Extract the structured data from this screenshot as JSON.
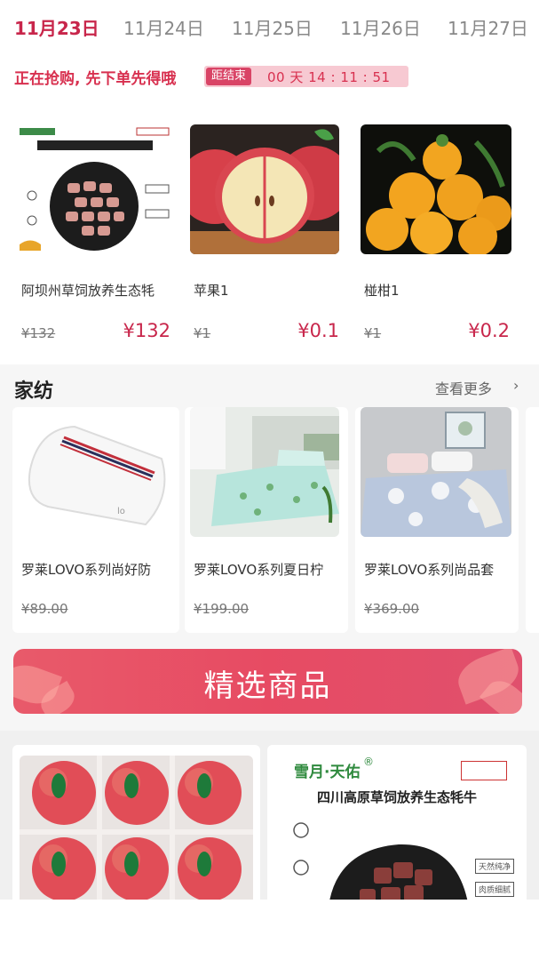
{
  "date_tabs": [
    "11月23日",
    "11月24日",
    "11月25日",
    "11月26日",
    "11月27日"
  ],
  "flash": {
    "title": "正在抢购, 先下单先得哦",
    "countdown_label": "距结束",
    "countdown_time": "00 天 14 : 11 : 51",
    "items": [
      {
        "name": "阿坝州草饲放养生态牦",
        "orig": "¥132",
        "price": "¥132",
        "image": "beef-package-image"
      },
      {
        "name": "苹果1",
        "orig": "¥1",
        "price": "¥0.1",
        "image": "apple-image"
      },
      {
        "name": "椪柑1",
        "orig": "¥1",
        "price": "¥0.2",
        "image": "orange-image"
      }
    ]
  },
  "textile": {
    "title": "家纺",
    "more": "查看更多",
    "items": [
      {
        "name": "罗莱LOVO系列尚好防",
        "orig": "¥89.00",
        "image": "pillow-image"
      },
      {
        "name": "罗莱LOVO系列夏日柠",
        "orig": "¥199.00",
        "image": "bed-sheet-image"
      },
      {
        "name": "罗莱LOVO系列尚品套",
        "orig": "¥369.00",
        "image": "bedding-set-image"
      }
    ]
  },
  "banner": {
    "title": "精选商品"
  },
  "products": [
    {
      "image": "apple-box-image"
    },
    {
      "brand": "雪月·天佑",
      "title": "四川高原草饲放养生态牦牛",
      "tag1": "天然纯净",
      "tag2": "肉质细腻"
    }
  ],
  "colors": {
    "accent": "#c8264b",
    "banner": "#e74b63"
  }
}
